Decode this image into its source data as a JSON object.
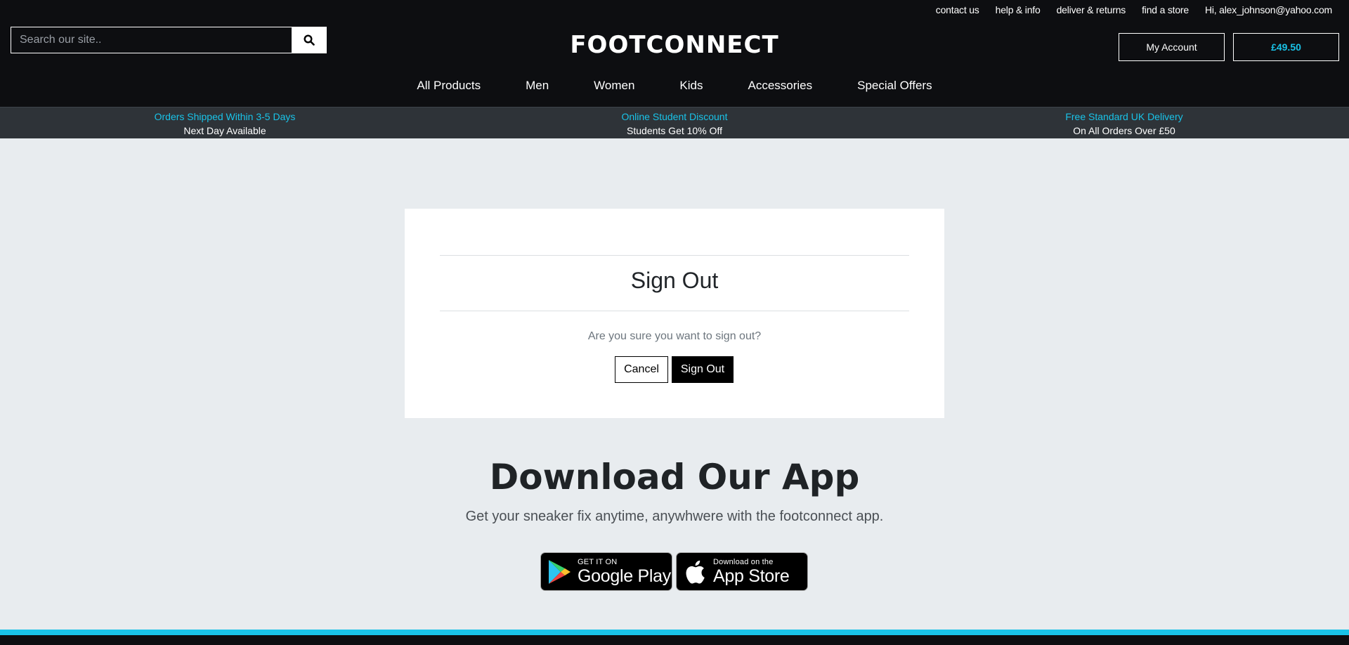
{
  "header": {
    "utility_links": [
      "contact us",
      "help & info",
      "deliver & returns",
      "find a store",
      "Hi, alex_johnson@yahoo.com"
    ],
    "search_placeholder": "Search our site..",
    "logo": "FOOTCONNECT",
    "account_label": "My Account",
    "basket_total": "£49.50",
    "nav": [
      "All Products",
      "Men",
      "Women",
      "Kids",
      "Accessories",
      "Special Offers"
    ]
  },
  "promos": [
    {
      "headline": "Orders Shipped Within 3-5 Days",
      "sub": "Next Day Available"
    },
    {
      "headline": "Online Student Discount",
      "sub": "Students Get 10% Off"
    },
    {
      "headline": "Free Standard UK Delivery",
      "sub": "On All Orders Over £50"
    }
  ],
  "signout": {
    "title": "Sign Out",
    "question": "Are you sure you want to sign out?",
    "cancel_label": "Cancel",
    "confirm_label": "Sign Out"
  },
  "app": {
    "title": "Download Our App",
    "subtitle": "Get your sneaker fix anytime, anywhwere with the footconnect app.",
    "google_small": "GET IT ON",
    "google_big": "Google Play",
    "apple_small": "Download on the",
    "apple_big": "App Store"
  },
  "colors": {
    "header_bg": "#0d0e11",
    "accent": "#19c3e8",
    "page_bg": "#e8ecef"
  }
}
